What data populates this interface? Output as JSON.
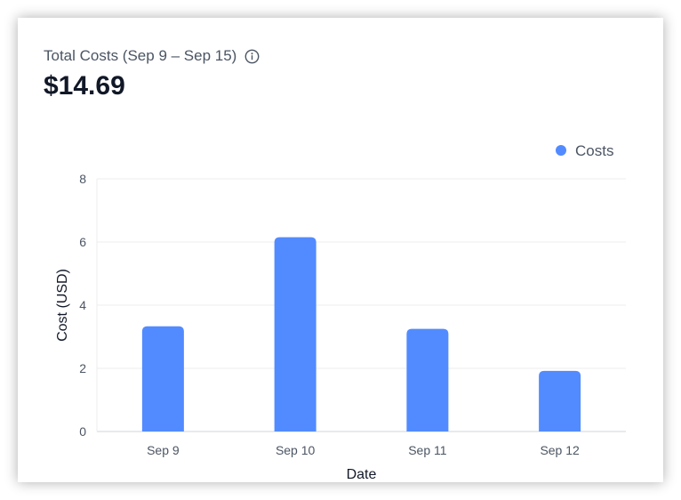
{
  "card": {
    "title": "Total Costs (Sep 9 – Sep 15)",
    "total": "$14.69",
    "info_icon": "info-circle-icon"
  },
  "chart_data": {
    "type": "bar",
    "categories": [
      "Sep 9",
      "Sep 10",
      "Sep 11",
      "Sep 12"
    ],
    "series": [
      {
        "name": "Costs",
        "values": [
          3.33,
          6.15,
          3.25,
          1.92
        ],
        "color": "#528bff"
      }
    ],
    "xlabel": "Date",
    "ylabel": "Cost (USD)",
    "ylim": [
      0,
      8
    ],
    "yticks": [
      0,
      2,
      4,
      6,
      8
    ],
    "grid": true,
    "legend": "top-right"
  }
}
